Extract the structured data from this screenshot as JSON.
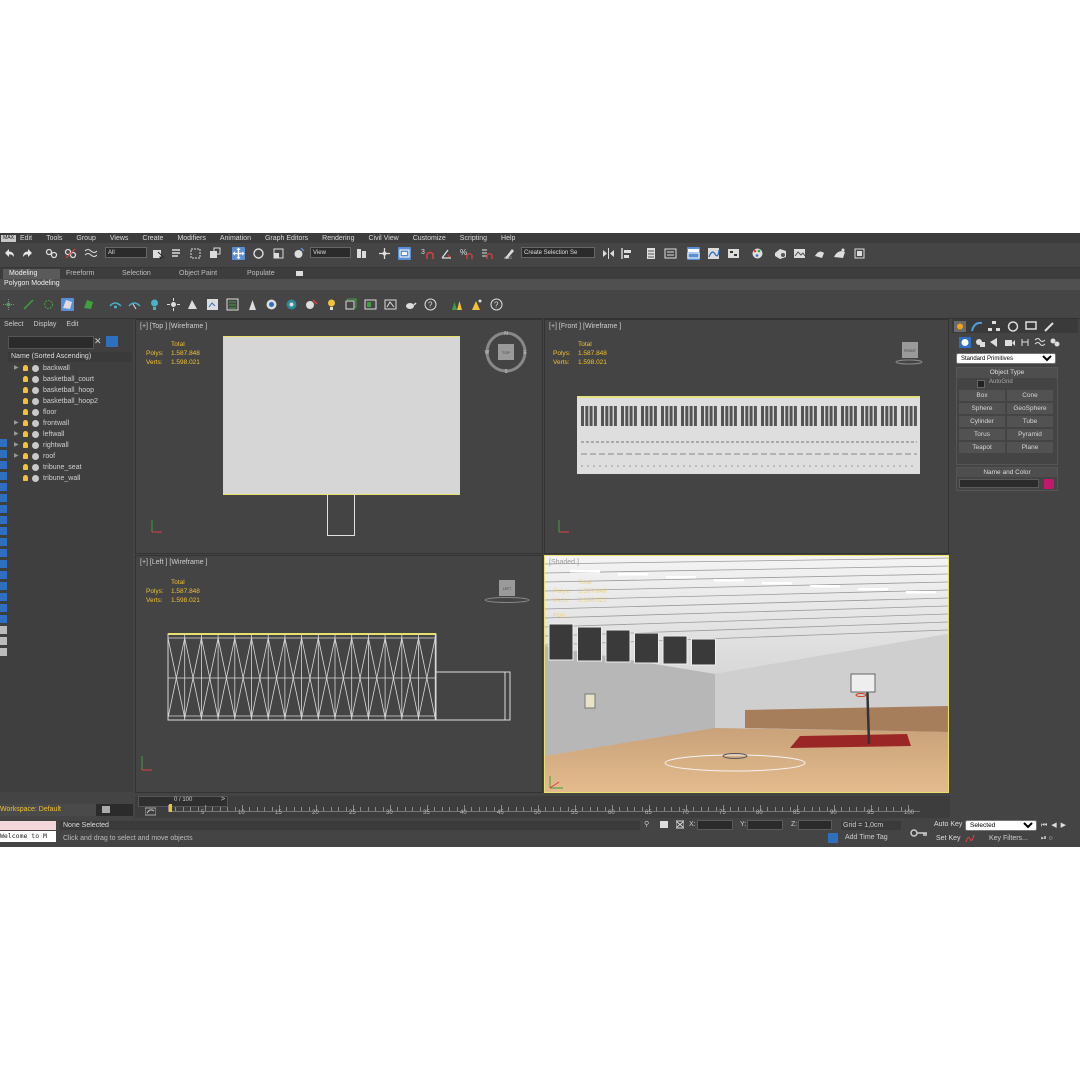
{
  "menu": [
    "Edit",
    "Tools",
    "Group",
    "Views",
    "Create",
    "Modifiers",
    "Animation",
    "Graph Editors",
    "Rendering",
    "Civil View",
    "Customize",
    "Scripting",
    "Help"
  ],
  "app_logo": "MAX",
  "toolbar": {
    "filter_value": "All",
    "refcoord_value": "View",
    "selection_set_placeholder": "Create Selection Se",
    "snap_label": "3",
    "angle_label": "%"
  },
  "ribbon": {
    "tabs": [
      "Modeling",
      "Freeform",
      "Selection",
      "Object Paint",
      "Populate"
    ],
    "active_tab": "Modeling",
    "sub_label": "Polygon Modeling"
  },
  "explorer": {
    "tabs": [
      "Select",
      "Display",
      "Edit"
    ],
    "column_header": "Name (Sorted Ascending)",
    "items": [
      {
        "name": "backwall",
        "expandable": true
      },
      {
        "name": "basketball_court",
        "expandable": false
      },
      {
        "name": "basketball_hoop",
        "expandable": false
      },
      {
        "name": "basketball_hoop2",
        "expandable": false
      },
      {
        "name": "floor",
        "expandable": false
      },
      {
        "name": "frontwall",
        "expandable": true
      },
      {
        "name": "leftwall",
        "expandable": true
      },
      {
        "name": "rightwall",
        "expandable": true
      },
      {
        "name": "roof",
        "expandable": true
      },
      {
        "name": "tribune_seat",
        "expandable": false
      },
      {
        "name": "tribune_wall",
        "expandable": false
      }
    ],
    "workspace": "Workspace: Default"
  },
  "viewports": {
    "top": {
      "label": "[+] [Top ] [Wireframe ]"
    },
    "front": {
      "label": "[+] [Front ] [Wireframe ]"
    },
    "left": {
      "label": "[+] [Left ] [Wireframe ]"
    },
    "persp": {
      "label": "[Shaded ]",
      "fps": "FPS:"
    },
    "stats": {
      "total": "Total",
      "polys_label": "Polys:",
      "polys": "1.587.848",
      "verts_label": "Verts:",
      "verts": "1.598.021"
    },
    "viewcube": {
      "top": "TOP",
      "front": "FRONT",
      "left": "LEFT",
      "north": "N",
      "south": "S",
      "east": "E",
      "west": "W"
    }
  },
  "command_panel": {
    "dropdown": "Standard Primitives",
    "object_type_title": "Object Type",
    "autogrid": "AutoGrid",
    "buttons": [
      "Box",
      "Cone",
      "Sphere",
      "GeoSphere",
      "Cylinder",
      "Tube",
      "Torus",
      "Pyramid",
      "Teapot",
      "Plane"
    ],
    "name_color_title": "Name and Color",
    "color": "#c2186b"
  },
  "timeline": {
    "frame_display": "0 / 100",
    "ticks": [
      "5",
      "10",
      "15",
      "20",
      "25",
      "30",
      "35",
      "40",
      "45",
      "50",
      "55",
      "60",
      "65",
      "70",
      "75",
      "80",
      "85",
      "90",
      "95",
      "100"
    ]
  },
  "status": {
    "selection": "None Selected",
    "prompt": "Click and drag to select and move objects",
    "listener": "Welcome to M",
    "x_label": "X:",
    "y_label": "Y:",
    "z_label": "Z:",
    "grid": "Grid = 1,0cm",
    "add_time_tag": "Add Time Tag",
    "auto_key": "Auto Key",
    "set_key": "Set Key",
    "key_mode": "Selected",
    "key_filters": "Key Filters..."
  },
  "colors": {
    "accent": "#5a8fd6",
    "stats": "#f0c030",
    "selection_yellow": "#e8e06a"
  }
}
